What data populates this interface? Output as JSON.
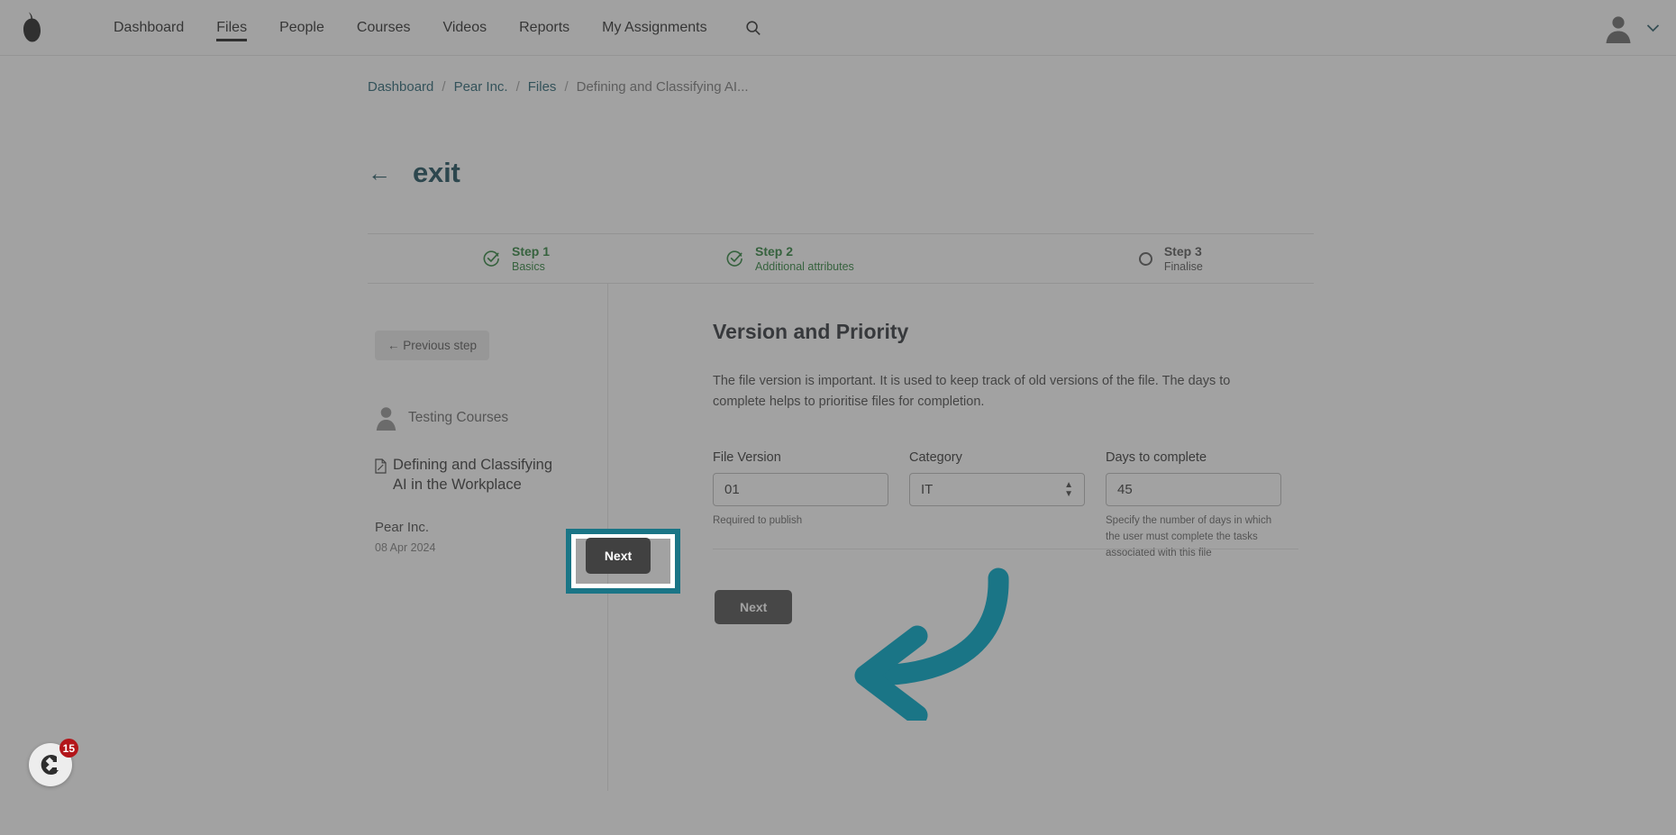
{
  "colors": {
    "accent_teal": "#1a7586",
    "brand_dark_teal": "#0c4250",
    "step_done_green": "#1f7a2e",
    "button_dark": "#414141",
    "badge_red": "#b3151a"
  },
  "topnav": {
    "logo_icon": "pear-logo-icon",
    "items": [
      {
        "label": "Dashboard",
        "active": false
      },
      {
        "label": "Files",
        "active": true
      },
      {
        "label": "People",
        "active": false
      },
      {
        "label": "Courses",
        "active": false
      },
      {
        "label": "Videos",
        "active": false
      },
      {
        "label": "Reports",
        "active": false
      },
      {
        "label": "My Assignments",
        "active": false
      }
    ],
    "search_icon": "search-icon",
    "account": {
      "avatar_icon": "user-avatar-icon",
      "chevron_icon": "chevron-down-icon"
    }
  },
  "breadcrumb": {
    "items": [
      {
        "label": "Dashboard",
        "current": false
      },
      {
        "label": "Pear Inc.",
        "current": false
      },
      {
        "label": "Files",
        "current": false
      },
      {
        "label": "Defining and Classifying AI...",
        "current": true
      }
    ],
    "separator": "/"
  },
  "exit": {
    "arrow_icon": "arrow-left-icon",
    "label": "exit"
  },
  "stepper": {
    "steps": [
      {
        "title": "Step 1",
        "sub": "Basics",
        "state": "done",
        "icon": "check-circle-icon"
      },
      {
        "title": "Step 2",
        "sub": "Additional attributes",
        "state": "done",
        "icon": "check-circle-icon"
      },
      {
        "title": "Step 3",
        "sub": "Finalise",
        "state": "todo",
        "icon": "empty-circle-icon"
      }
    ]
  },
  "sidebar": {
    "previous_step_label": "← Previous step",
    "course": {
      "avatar_icon": "user-avatar-icon",
      "name": "Testing Courses"
    },
    "file": {
      "icon": "file-document-icon",
      "title": "Defining and Classifying AI in the Workplace"
    },
    "organisation": "Pear Inc.",
    "date": "08 Apr 2024"
  },
  "main": {
    "title": "Version and Priority",
    "description": "The file version is important. It is used to keep track of old versions of the file. The days to complete helps to prioritise files for completion.",
    "fields": [
      {
        "key": "file_version",
        "label": "File Version",
        "type": "text",
        "value": "01",
        "placeholder": "",
        "hint": "Required to publish"
      },
      {
        "key": "category",
        "label": "Category",
        "type": "select",
        "value": "IT",
        "options": [
          "IT"
        ],
        "hint": ""
      },
      {
        "key": "days_to_complete",
        "label": "Days to complete",
        "type": "text",
        "value": "45",
        "placeholder": "",
        "hint": "Specify the number of days in which the user must complete the tasks associated with this file"
      }
    ],
    "next_label": "Next"
  },
  "annotation": {
    "highlight_target": "next-button",
    "arrow_icon": "curved-arrow-left-icon",
    "arrow_color": "#1a7586"
  },
  "help_widget": {
    "icon": "chat-help-icon",
    "badge_count": "15"
  }
}
